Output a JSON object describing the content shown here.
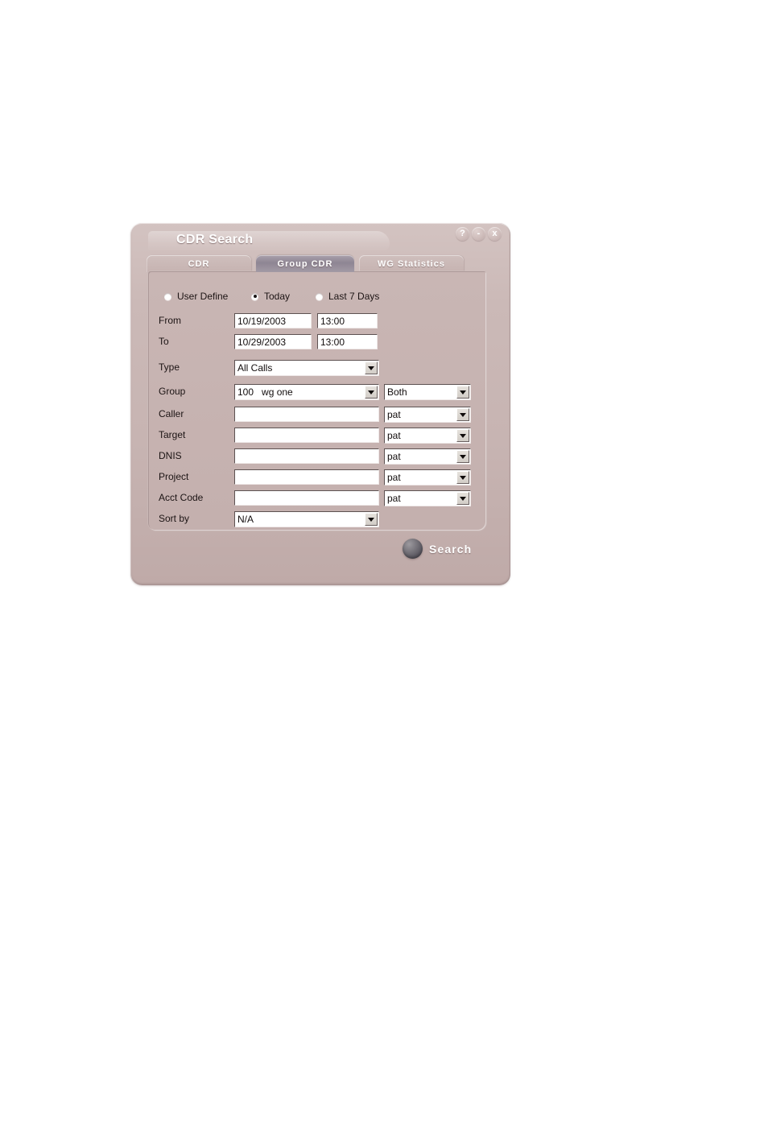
{
  "window": {
    "title": "CDR Search",
    "controls": [
      {
        "name": "help-button",
        "glyph": "?"
      },
      {
        "name": "minimize-button",
        "glyph": "-"
      },
      {
        "name": "close-button",
        "glyph": "x"
      }
    ]
  },
  "tabs": [
    {
      "label": "CDR",
      "active": false
    },
    {
      "label": "Group CDR",
      "active": true
    },
    {
      "label": "WG Statistics",
      "active": false
    }
  ],
  "date_range_options": [
    {
      "label": "User Define",
      "selected": false
    },
    {
      "label": "Today",
      "selected": true
    },
    {
      "label": "Last 7 Days",
      "selected": false
    }
  ],
  "fields": {
    "from": {
      "label": "From",
      "date_value": "10/19/2003",
      "time_value": "13:00"
    },
    "to": {
      "label": "To",
      "date_value": "10/29/2003",
      "time_value": "13:00"
    },
    "type": {
      "label": "Type",
      "value": "All Calls"
    },
    "group": {
      "label": "Group",
      "value": "100   wg one",
      "direction_value": "Both"
    },
    "caller": {
      "label": "Caller",
      "value": "",
      "match_value": "pat"
    },
    "target": {
      "label": "Target",
      "value": "",
      "match_value": "pat"
    },
    "dnis": {
      "label": "DNIS",
      "value": "",
      "match_value": "pat"
    },
    "project": {
      "label": "Project",
      "value": "",
      "match_value": "pat"
    },
    "acct_code": {
      "label": "Acct Code",
      "value": "",
      "match_value": "pat"
    },
    "sort_by": {
      "label": "Sort by",
      "value": "N/A"
    }
  },
  "actions": {
    "search_label": "Search"
  },
  "colors": {
    "window_background": "#c7b4b2",
    "panel_background": "#c6b2b0",
    "active_tab": "#8e8593",
    "inactive_tab": "#c9b6b4",
    "field_background": "#ffffff",
    "text": "#1c1414",
    "title_text": "#ffffff",
    "page_background": "#ffffff"
  }
}
